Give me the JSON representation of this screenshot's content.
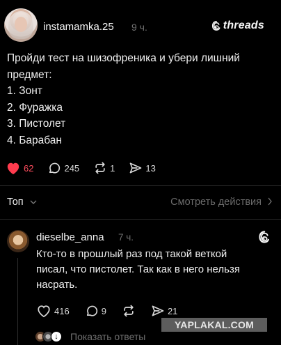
{
  "post": {
    "username": "instamamka.25",
    "time": "9 ч.",
    "brand": "threads",
    "text_lines": [
      "Пройди тест на шизофреника и убери лишний",
      "предмет:",
      "1. Зонт",
      "2. Фуражка",
      "3. Пистолет",
      "4. Барабан"
    ],
    "likes": "62",
    "comments": "245",
    "reposts": "1",
    "shares": "13",
    "like_color": "#ff3b4e"
  },
  "sort": {
    "label": "Топ",
    "view_actions": "Смотреть действия"
  },
  "reply": {
    "username": "dieselbe_anna",
    "time": "7 ч.",
    "text_lines": [
      "Кто-то в прошлый раз под такой веткой",
      "писал, что пистолет. Так как в него нельзя",
      "насрать."
    ],
    "likes": "416",
    "comments": "9",
    "shares": "21",
    "show_replies": "Показать ответы"
  },
  "watermark": "YAPLAKAL.COM",
  "icons": [
    "heart-icon",
    "comment-icon",
    "repost-icon",
    "share-icon",
    "threads-logo-icon",
    "chevron-down-icon",
    "chevron-right-icon"
  ]
}
